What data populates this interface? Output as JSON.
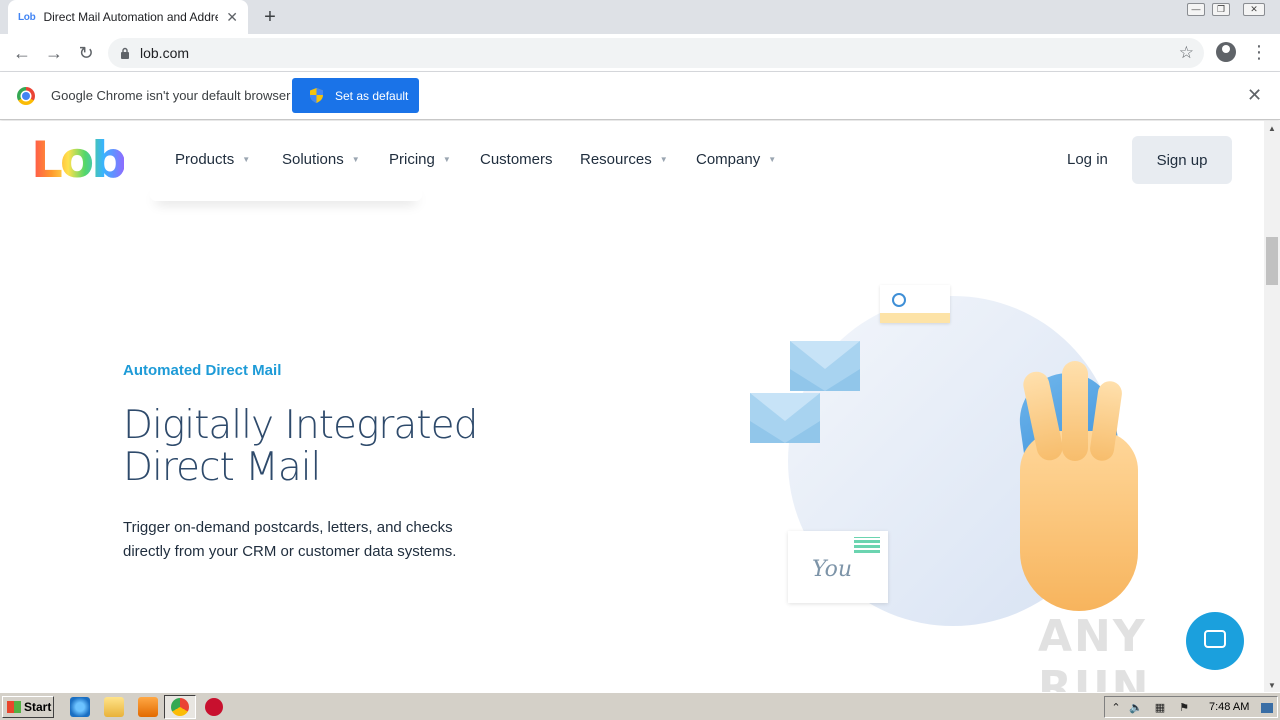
{
  "browser": {
    "tab_title": "Direct Mail Automation and Address",
    "tab_favicon_text": "Lob",
    "url": "lob.com",
    "infobar_message": "Google Chrome isn't your default browser",
    "infobar_button": "Set as default"
  },
  "site": {
    "logo": "Lob",
    "nav": [
      {
        "label": "Products",
        "has_dropdown": true
      },
      {
        "label": "Solutions",
        "has_dropdown": true
      },
      {
        "label": "Pricing",
        "has_dropdown": true
      },
      {
        "label": "Customers",
        "has_dropdown": false
      },
      {
        "label": "Resources",
        "has_dropdown": true
      },
      {
        "label": "Company",
        "has_dropdown": true
      }
    ],
    "login": "Log in",
    "signup": "Sign up"
  },
  "hero": {
    "eyebrow": "Automated Direct Mail",
    "headline_line1": "Digitally Integrated",
    "headline_line2": "Direct Mail",
    "subtext": "Trigger on-demand postcards, letters, and checks directly from your CRM or customer data systems.",
    "postcard_script": "You"
  },
  "overlay": {
    "watermark": "ANY RUN"
  },
  "taskbar": {
    "start_label": "Start",
    "clock": "7:48 AM"
  },
  "colors": {
    "accent": "#1e9bd7",
    "headline": "#2e4a6b",
    "chrome_button": "#1a73e8"
  }
}
